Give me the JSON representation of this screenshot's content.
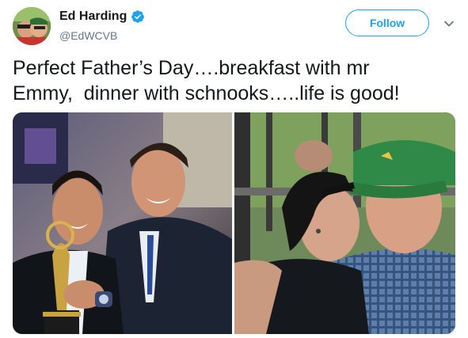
{
  "user": {
    "display_name": "Ed Harding",
    "handle": "@EdWCVB",
    "verified": true,
    "avatar_icon": "user-avatar-photo"
  },
  "actions": {
    "follow_label": "Follow",
    "more_icon": "chevron-down-icon"
  },
  "tweet": {
    "text": "Perfect Father’s Day….breakfast with mr\nEmmy,  dinner with schnooks…..life is good!"
  },
  "media": {
    "photos": [
      {
        "description_icon": "photo-emmy-award"
      },
      {
        "description_icon": "photo-kiss-green-visor"
      }
    ]
  },
  "colors": {
    "accent": "#1da1f2",
    "text": "#14171a",
    "secondary": "#657786"
  }
}
